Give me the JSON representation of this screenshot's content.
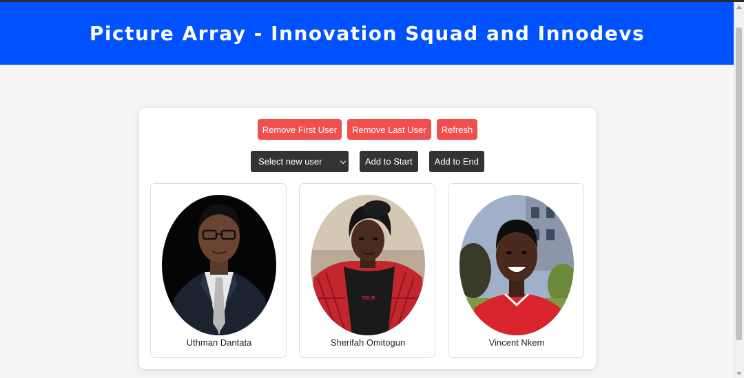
{
  "header": {
    "title": "Picture Array - Innovation Squad and Innodevs",
    "background": "#0052ff"
  },
  "controls": {
    "remove_first_label": "Remove First User",
    "remove_last_label": "Remove Last User",
    "refresh_label": "Refresh",
    "select_value": "Select new user",
    "add_start_label": "Add to Start",
    "add_end_label": "Add to End",
    "red_button_color": "#ef4f4f",
    "dark_button_color": "#333333"
  },
  "users": [
    {
      "name": "Uthman Dantata",
      "photo": "portrait-man-glasses-suit"
    },
    {
      "name": "Sherifah Omitogun",
      "photo": "portrait-woman-headwrap"
    },
    {
      "name": "Vincent Nkem",
      "photo": "portrait-young-man-smiling"
    }
  ]
}
